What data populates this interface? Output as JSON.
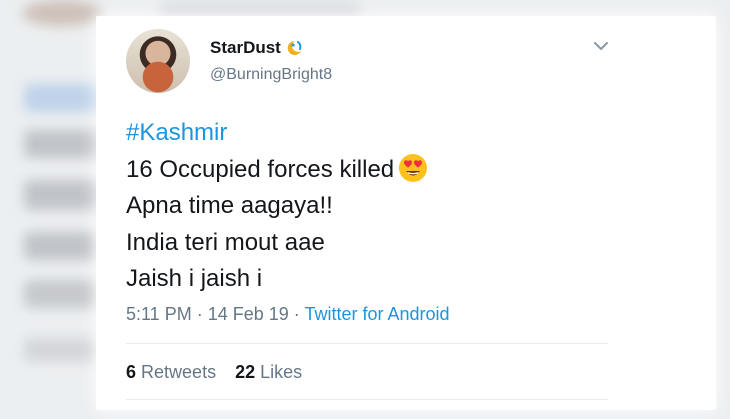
{
  "tweet": {
    "display_name": "StarDust",
    "handle": "@BurningBright8",
    "hashtag": "#Kashmir",
    "lines": [
      "16 Occupied forces killed",
      "Apna time aagaya!!",
      "India teri mout aae",
      "Jaish i jaish i"
    ],
    "time": "5:11 PM",
    "separator": " · ",
    "date": "14 Feb 19",
    "source": "Twitter for Android",
    "retweets_count": "6",
    "retweets_label": "Retweets",
    "likes_count": "22",
    "likes_label": "Likes"
  },
  "icons": {
    "name_badge": "crescent-star-icon",
    "emoji": "heart-eyes-emoji-icon",
    "menu": "chevron-down-icon"
  },
  "colors": {
    "link": "#1b95e0",
    "text": "#14171a",
    "muted": "#657786"
  }
}
